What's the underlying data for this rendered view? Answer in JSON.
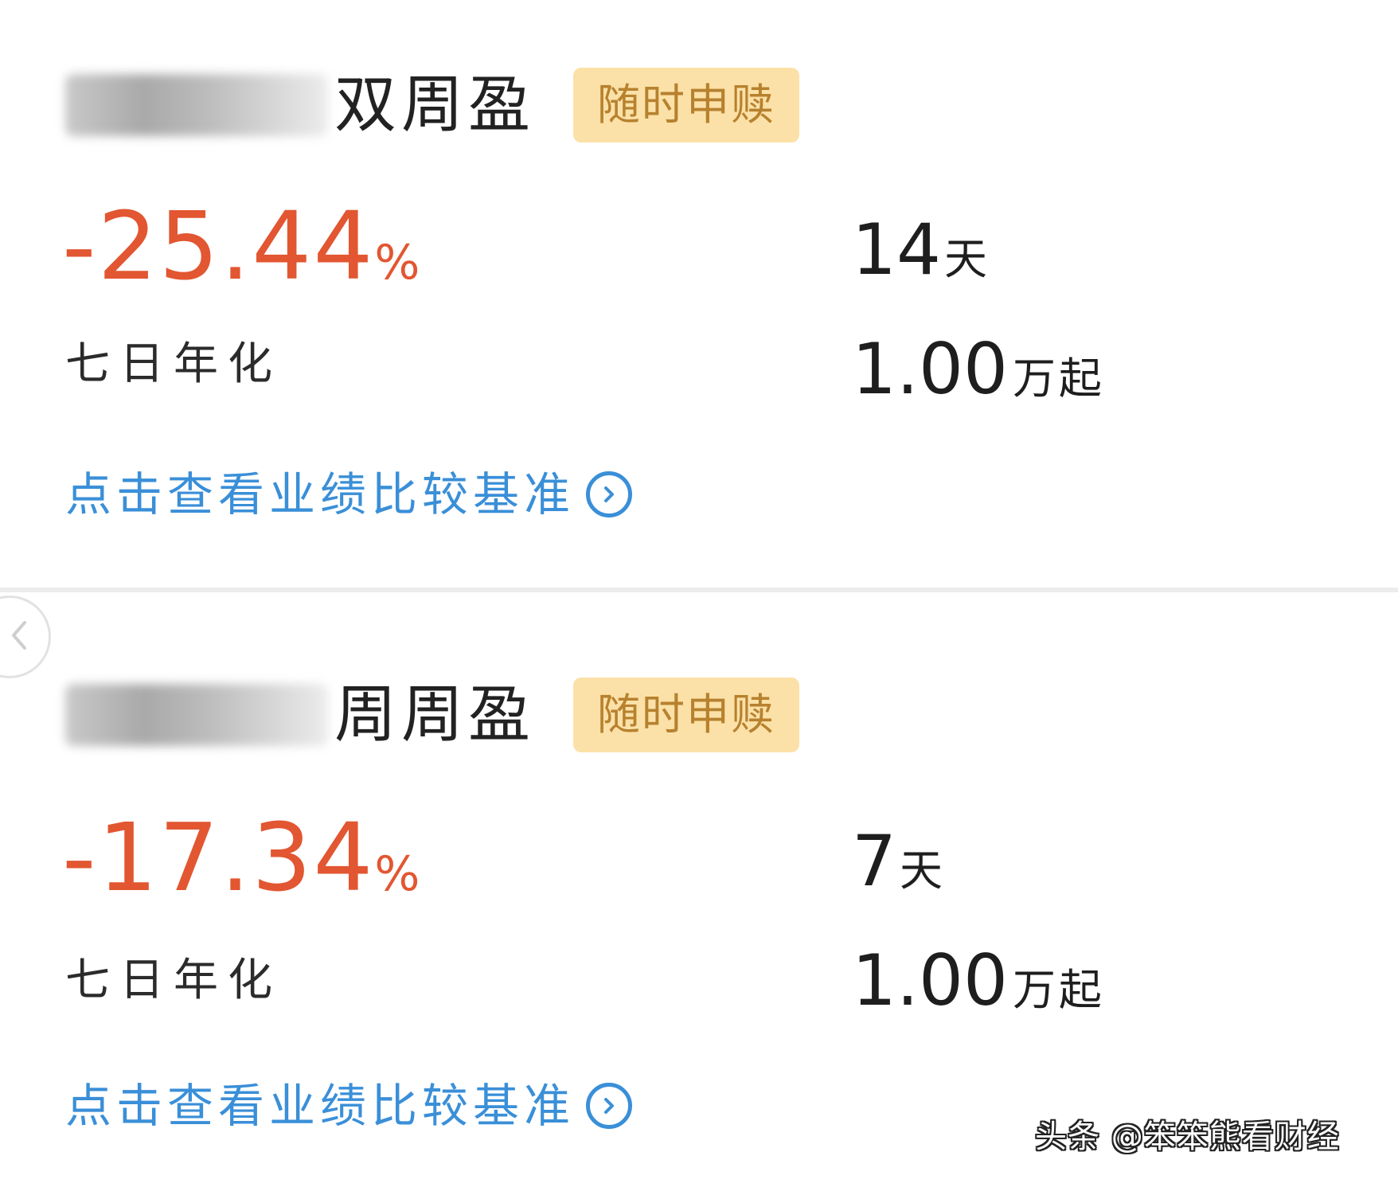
{
  "products": [
    {
      "name_suffix": "双周盈",
      "tag": "随时申赎",
      "rate_value": "-25.44",
      "rate_unit": "%",
      "rate_label": "七日年化",
      "period_value": "14",
      "period_unit": "天",
      "min_value": "1.00",
      "min_unit": "万起",
      "benchmark_link": "点击查看业绩比较基准"
    },
    {
      "name_suffix": "周周盈",
      "tag": "随时申赎",
      "rate_value": "-17.34",
      "rate_unit": "%",
      "rate_label": "七日年化",
      "period_value": "7",
      "period_unit": "天",
      "min_value": "1.00",
      "min_unit": "万起",
      "benchmark_link": "点击查看业绩比较基准"
    }
  ],
  "watermark": "头条 @笨笨熊看财经",
  "colors": {
    "rate": "#e25631",
    "tag_bg": "#fbe1a8",
    "tag_text": "#b7812e",
    "link": "#3a8fd8"
  },
  "icons": {
    "link_icon": "chevron-right-circle-icon",
    "back_icon": "chevron-left-icon"
  }
}
